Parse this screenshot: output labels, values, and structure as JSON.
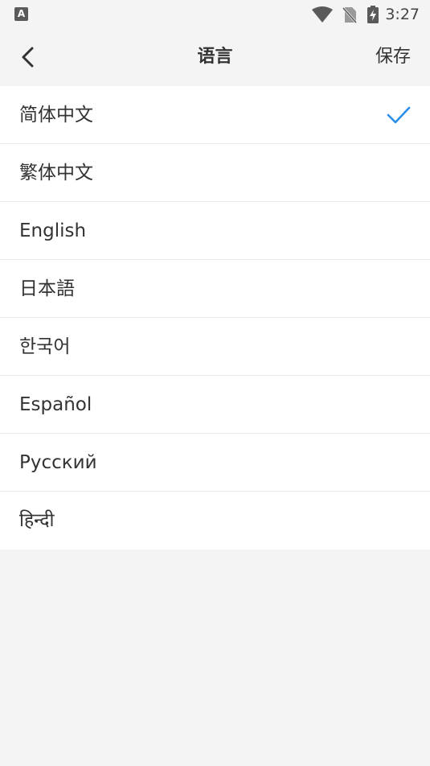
{
  "status_bar": {
    "left_icon": "keyboard-a-icon",
    "left_icon_letter": "A",
    "icons": [
      "wifi-icon",
      "no-sim-icon",
      "battery-charging-icon"
    ],
    "time": "3:27"
  },
  "header": {
    "back_icon": "chevron-left-icon",
    "title": "语言",
    "save_label": "保存"
  },
  "languages": {
    "items": [
      {
        "label": "简体中文",
        "selected": true
      },
      {
        "label": "繁体中文",
        "selected": false
      },
      {
        "label": "English",
        "selected": false
      },
      {
        "label": "日本語",
        "selected": false
      },
      {
        "label": "한국어",
        "selected": false
      },
      {
        "label": "Español",
        "selected": false
      },
      {
        "label": "Русский",
        "selected": false
      },
      {
        "label": "हिन्दी",
        "selected": false
      }
    ]
  },
  "colors": {
    "accent": "#2a8ee8",
    "background": "#f4f4f4",
    "list_background": "#ffffff",
    "text": "#333333"
  }
}
